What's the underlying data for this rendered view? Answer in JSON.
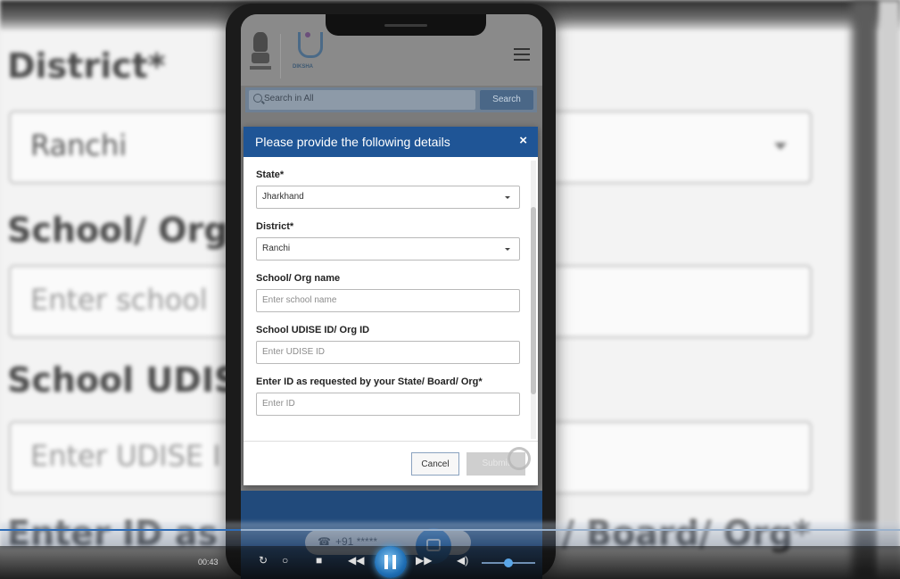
{
  "background_form": {
    "district_label": "District*",
    "district_value": "Ranchi",
    "school_label": "School/ Org na",
    "school_placeholder": "Enter school",
    "udise_label": "School UDISE I",
    "udise_placeholder": "Enter UDISE I",
    "id_label_left": "Enter ID as re",
    "id_label_right": "/ Board/ Org*"
  },
  "app": {
    "logo_text": "DIKSHA",
    "search_placeholder": "Search in All",
    "search_button": "Search"
  },
  "modal": {
    "title": "Please provide the following details",
    "close_glyph": "×",
    "state_label": "State*",
    "state_value": "Jharkhand",
    "district_label": "District*",
    "district_value": "Ranchi",
    "school_label": "School/ Org name",
    "school_placeholder": "Enter school name",
    "udise_label": "School UDISE ID/ Org ID",
    "udise_placeholder": "Enter UDISE ID",
    "id_label": "Enter ID as requested by your State/ Board/ Org*",
    "id_placeholder": "Enter ID",
    "cancel_label": "Cancel",
    "submit_label": "Submit"
  },
  "footer": {
    "phone_glyph": "☎",
    "phone_text": "+91 *****"
  },
  "player": {
    "time": "00:43",
    "buttons": [
      "↻",
      "○",
      "■",
      "◀◀",
      "▶▶",
      "◀)"
    ],
    "accent": "#2e6db8"
  }
}
